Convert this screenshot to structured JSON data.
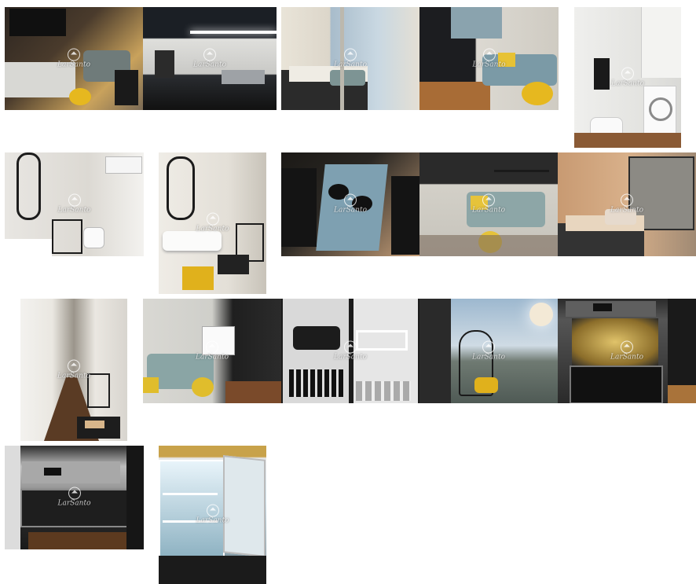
{
  "gallery": {
    "watermark": "LarSanto",
    "photos": [
      {
        "id": "p1",
        "alt": "living-dining",
        "colors": [
          "#3a3128",
          "#c9a25c",
          "#6f7b7a",
          "#1d1d1d"
        ]
      },
      {
        "id": "p2",
        "alt": "kitchen-sink",
        "colors": [
          "#20242a",
          "#d8d8d8",
          "#5a5e63",
          "#111"
        ]
      },
      {
        "id": "p3",
        "alt": "bedroom-window",
        "colors": [
          "#d8d3c9",
          "#9fb6c4",
          "#2b2b2b",
          "#e9e4d8"
        ]
      },
      {
        "id": "p4",
        "alt": "living-window",
        "colors": [
          "#1e1f22",
          "#7b9aa6",
          "#b77b3f",
          "#e7c234"
        ]
      },
      {
        "id": "p5",
        "alt": "bathroom-washer",
        "colors": [
          "#efefed",
          "#d9d9d6",
          "#2a2a2a",
          "#7aa9b0"
        ]
      },
      {
        "id": "p6",
        "alt": "bathroom-mirror",
        "colors": [
          "#e8e6e2",
          "#cfcac2",
          "#1d1d1d",
          "#9e9b94"
        ]
      },
      {
        "id": "p7",
        "alt": "bathroom-basin",
        "colors": [
          "#efece6",
          "#c8c3b9",
          "#1b1b1b",
          "#e0b11c"
        ]
      },
      {
        "id": "p8",
        "alt": "dining-table",
        "colors": [
          "#2a2723",
          "#7ea0b1",
          "#c7a07a",
          "#141414"
        ]
      },
      {
        "id": "p9",
        "alt": "sofa",
        "colors": [
          "#d3d0c8",
          "#8da6a7",
          "#e6c33a",
          "#2a2a2a"
        ]
      },
      {
        "id": "p10",
        "alt": "bedroom-balcony",
        "colors": [
          "#c89a72",
          "#e8d6bf",
          "#333",
          "#9b7456"
        ]
      },
      {
        "id": "p11",
        "alt": "corridor",
        "colors": [
          "#eae7e1",
          "#5a3b24",
          "#1d1d1d",
          "#c9c5bd"
        ]
      },
      {
        "id": "p12",
        "alt": "living-corner",
        "colors": [
          "#cfcfca",
          "#8aa5a5",
          "#e0bd2c",
          "#2b2b2b"
        ]
      },
      {
        "id": "p13",
        "alt": "cupboard-kitchenware",
        "colors": [
          "#1c1c1c",
          "#d9d9d9",
          "#6e6e6e",
          "#eeeeee"
        ]
      },
      {
        "id": "p14",
        "alt": "balcony-view",
        "colors": [
          "#9db8cf",
          "#f3e9d6",
          "#4f5a55",
          "#2a2a2a"
        ]
      },
      {
        "id": "p15",
        "alt": "microwave-open",
        "colors": [
          "#2a2a2a",
          "#bfa65a",
          "#7a7a7a",
          "#a9733a"
        ]
      },
      {
        "id": "p16",
        "alt": "oven",
        "colors": [
          "#2c2c2c",
          "#9a9a9a",
          "#5c3a1f",
          "#dcdcdc"
        ]
      },
      {
        "id": "p17",
        "alt": "fridge-open",
        "colors": [
          "#cfe4ee",
          "#5f7883",
          "#1b1b1b",
          "#e7c96a"
        ]
      }
    ]
  }
}
